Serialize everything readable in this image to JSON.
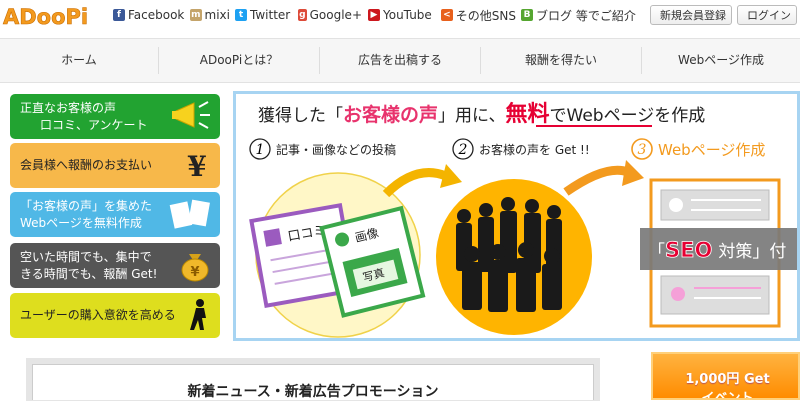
{
  "header": {
    "logo": "ADooPi",
    "sns": [
      {
        "label": "Facebook",
        "icon": "facebook-icon",
        "color": "#3b5998",
        "glyph": "f"
      },
      {
        "label": "mixi",
        "icon": "mixi-icon",
        "color": "#c4a46a",
        "glyph": "m"
      },
      {
        "label": "Twitter",
        "icon": "twitter-icon",
        "color": "#1da1f2",
        "glyph": "t"
      },
      {
        "label": "Google+",
        "icon": "google-plus-icon",
        "color": "#dd4b39",
        "glyph": "g"
      },
      {
        "label": "YouTube",
        "icon": "youtube-icon",
        "color": "#cc181e",
        "glyph": "▶"
      },
      {
        "label": "その他SNS",
        "icon": "share-icon",
        "color": "#e8601c",
        "glyph": "<"
      },
      {
        "label": "ブログ 等でご紹介",
        "icon": "blog-icon",
        "color": "#55a630",
        "glyph": "B"
      }
    ],
    "register_label": "新規会員登録",
    "login_label": "ログイン"
  },
  "nav": [
    "ホーム",
    "ADooPiとは？",
    "広告を出稿する",
    "報酬を得たい",
    "Webページ作成"
  ],
  "sidebar": [
    {
      "lines": [
        "正直なお客様の声",
        "口コミ、アンケート"
      ],
      "bg": "#22a331",
      "color": "#ffffff",
      "icon": "megaphone-icon"
    },
    {
      "lines": [
        "会員様へ報酬のお支払い"
      ],
      "bg": "#f7b84a",
      "color": "#222222",
      "icon": "yen-icon"
    },
    {
      "lines": [
        "「お客様の声」を集めた",
        "Webページを無料作成"
      ],
      "bg": "#50b8e6",
      "color": "#ffffff",
      "icon": "documents-icon"
    },
    {
      "lines": [
        "空いた時間でも、集中で",
        "きる時間でも、報酬 Get!"
      ],
      "bg": "#555555",
      "color": "#ffffff",
      "icon": "money-bag-icon"
    },
    {
      "lines": [
        "ユーザーの購入意欲を高める"
      ],
      "bg": "#dede1e",
      "color": "#222222",
      "icon": "climber-icon"
    }
  ],
  "banner": {
    "headline_pre": "獲得した「",
    "headline_voice": "お客様の声",
    "headline_mid": "」用に、",
    "headline_free": "無料",
    "headline_de": "で",
    "headline_web": "Webページ",
    "headline_end": "を作成",
    "step1_num": "1",
    "step1": "記事・画像などの投稿",
    "step2_num": "2",
    "step2": "お客様の声を Get !!",
    "step3_num": "3",
    "step3": "Webページ作成",
    "card1": "口コミ",
    "card2": "画像",
    "card2_photo": "写真",
    "seo_open": "「",
    "seo_word": "SEO",
    "seo_rest": "対策」付"
  },
  "news_title": "新着ニュース・新着広告プロモーション",
  "promo": {
    "line1": "1,000円 Get",
    "line2": "イベント"
  }
}
